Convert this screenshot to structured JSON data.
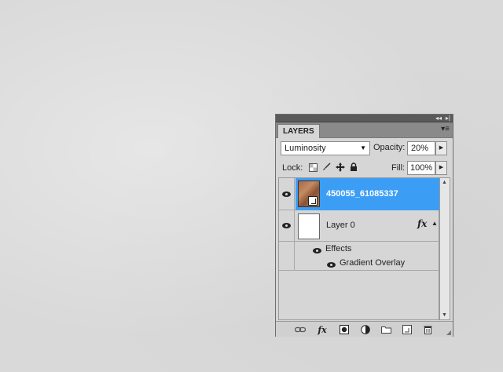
{
  "panel": {
    "tab_label": "LAYERS",
    "collapse_glyph": "◂◂",
    "close_glyph": "▸|",
    "menu_glyph": "▾≡"
  },
  "controls": {
    "blend_mode": "Luminosity",
    "opacity_label": "Opacity:",
    "opacity_value": "20%",
    "lock_label": "Lock:",
    "fill_label": "Fill:",
    "fill_value": "100%"
  },
  "layers": [
    {
      "name": "450055_61085337",
      "selected": true,
      "type": "smart-object"
    },
    {
      "name": "Layer 0",
      "selected": false,
      "type": "pixel",
      "fx": "fx"
    }
  ],
  "effects": {
    "group_label": "Effects",
    "items": [
      {
        "label": "Gradient Overlay"
      }
    ]
  },
  "bottom_toolbar": [
    {
      "icon": "link-layers-icon"
    },
    {
      "icon": "fx-icon",
      "text": "fx"
    },
    {
      "icon": "add-mask-icon"
    },
    {
      "icon": "adjustment-layer-icon"
    },
    {
      "icon": "new-group-icon"
    },
    {
      "icon": "new-layer-icon"
    },
    {
      "icon": "delete-layer-icon"
    }
  ],
  "colors": {
    "selection": "#3c9df5",
    "panel_bg": "#d6d6d6"
  }
}
